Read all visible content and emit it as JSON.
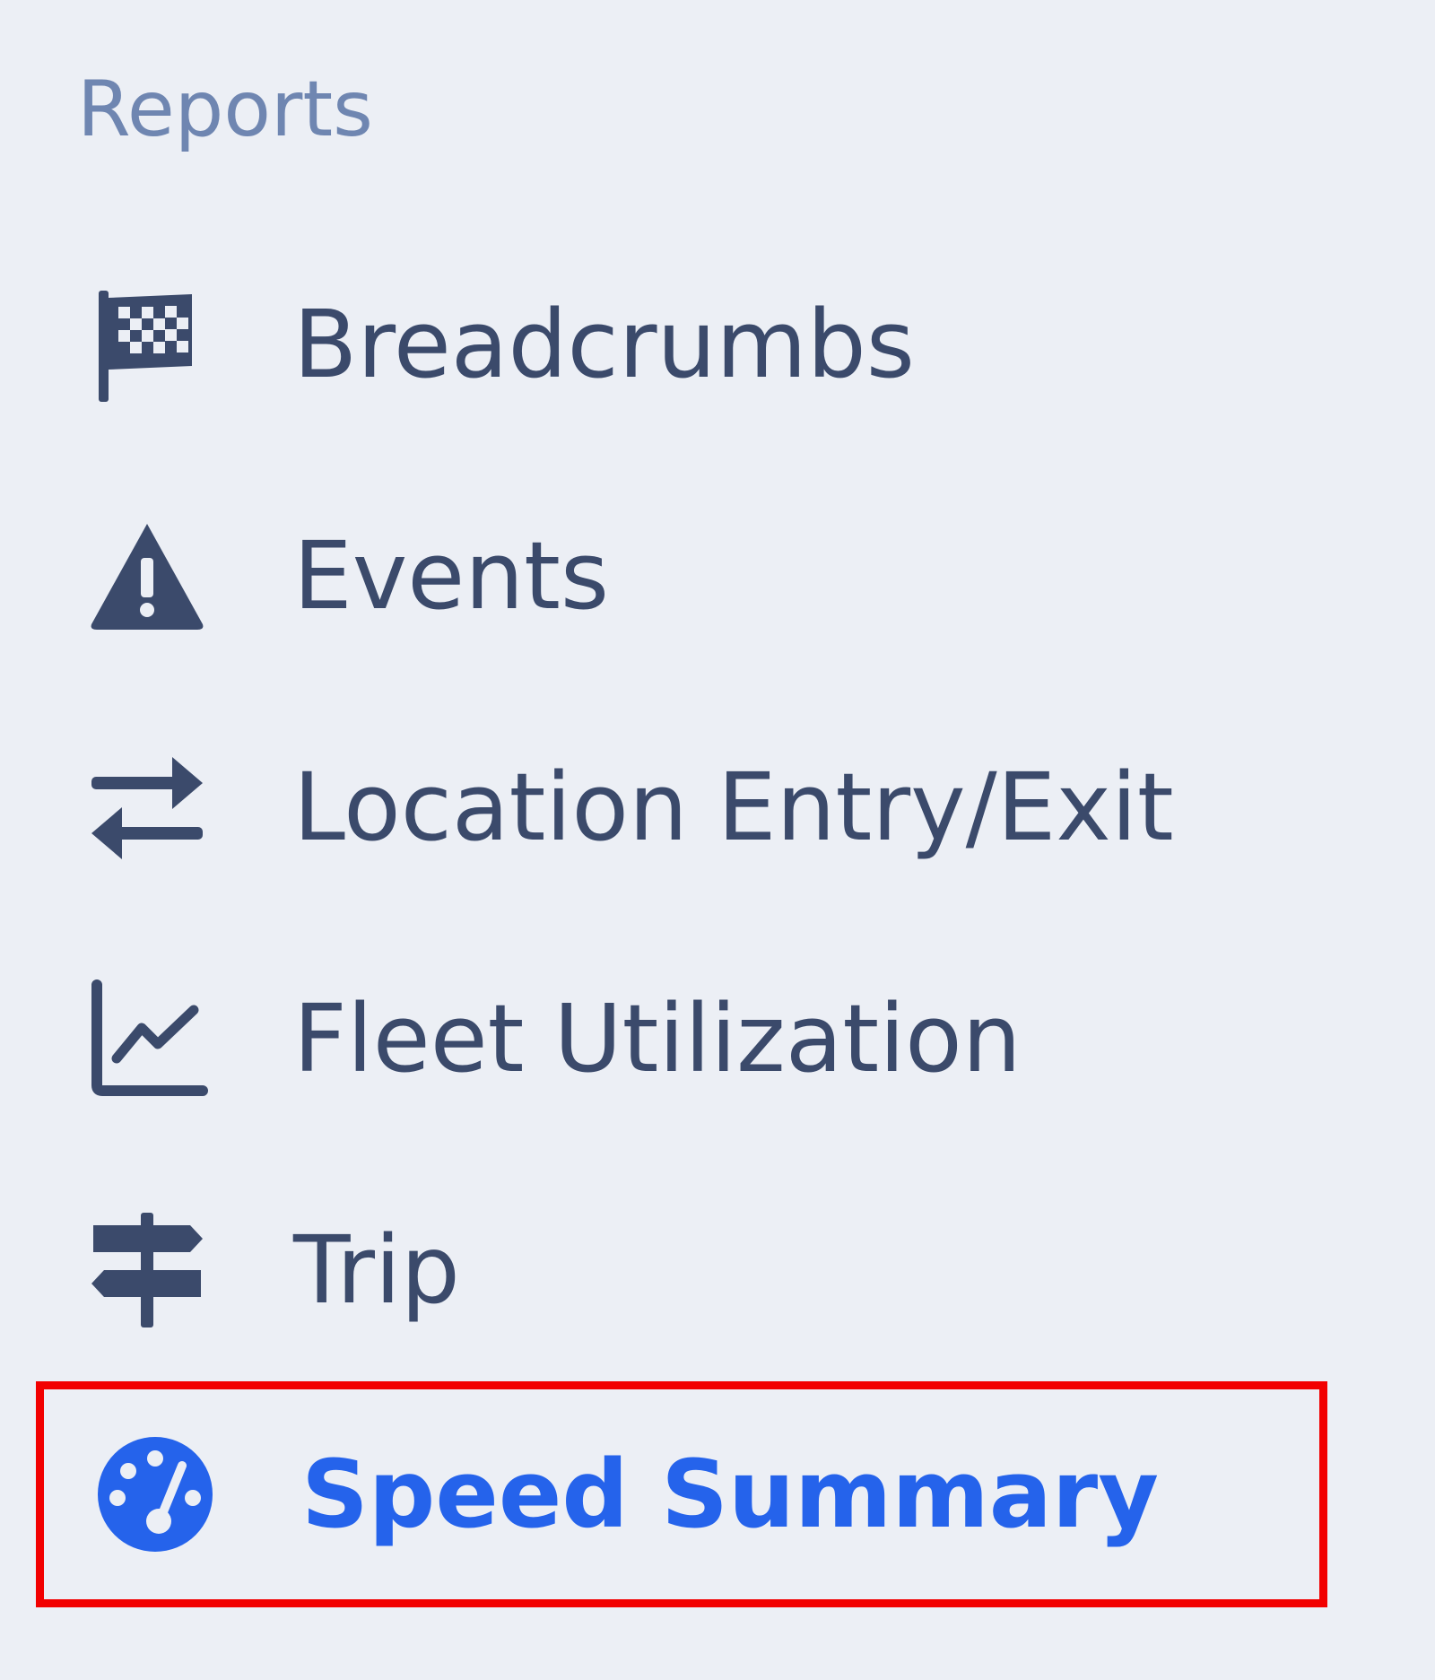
{
  "sidebar": {
    "section_title": "Reports",
    "items": [
      {
        "label": "Breadcrumbs",
        "icon": "checkered-flag-icon"
      },
      {
        "label": "Events",
        "icon": "warning-triangle-icon"
      },
      {
        "label": "Location Entry/Exit",
        "icon": "arrows-exchange-icon"
      },
      {
        "label": "Fleet Utilization",
        "icon": "line-chart-icon"
      },
      {
        "label": "Trip",
        "icon": "signpost-icon"
      },
      {
        "label": "Speed Summary",
        "icon": "speedometer-icon",
        "selected": true
      }
    ]
  },
  "colors": {
    "background": "#eceff5",
    "section_title": "#6f86b1",
    "item_text": "#3b4a6b",
    "active_text": "#2563eb",
    "highlight_border": "#f20000"
  }
}
